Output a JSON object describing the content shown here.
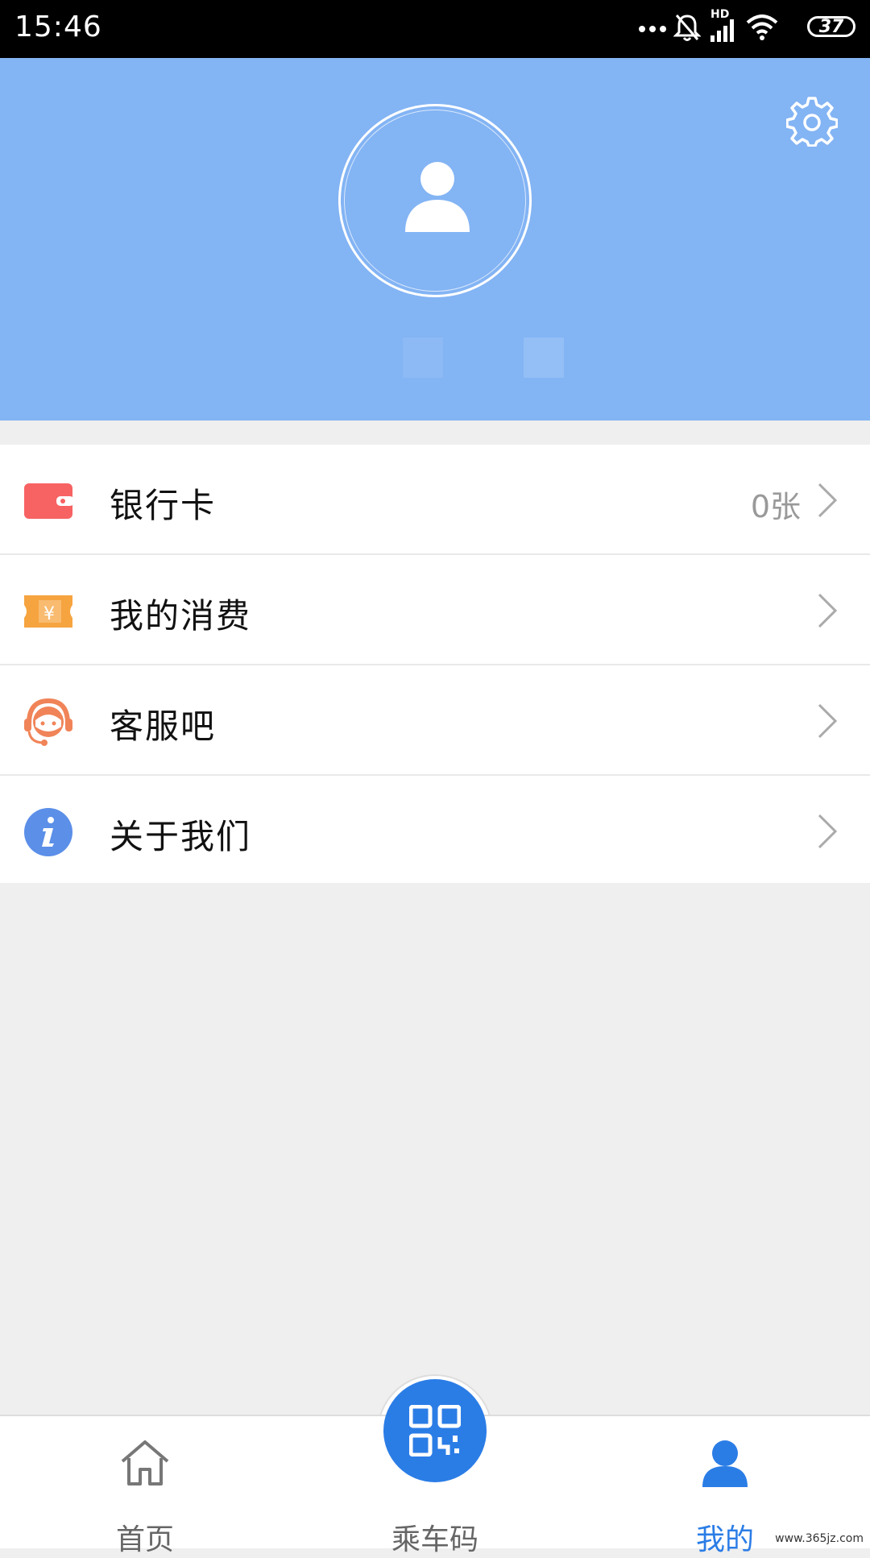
{
  "status_bar": {
    "time": "15:46",
    "battery": "37",
    "network": "HD"
  },
  "header": {
    "background_color": "#83b4f4",
    "settings_icon": "gear-icon",
    "avatar_icon": "user-icon"
  },
  "menu": {
    "items": [
      {
        "label": "银行卡",
        "value": "0张",
        "icon": "wallet-icon",
        "icon_color": "#f76263"
      },
      {
        "label": "我的消费",
        "value": "",
        "icon": "ticket-icon",
        "icon_color": "#f6a440"
      },
      {
        "label": "客服吧",
        "value": "",
        "icon": "headset-icon",
        "icon_color": "#f08458"
      },
      {
        "label": "关于我们",
        "value": "",
        "icon": "info-icon",
        "icon_color": "#5b8fe8"
      }
    ]
  },
  "tab_bar": {
    "tabs": [
      {
        "label": "首页",
        "icon": "home-icon",
        "active": false
      },
      {
        "label": "乘车码",
        "icon": "qr-code-icon",
        "active": false
      },
      {
        "label": "我的",
        "icon": "profile-icon",
        "active": true
      }
    ],
    "accent_color": "#2b7de6"
  },
  "watermark": "www.365jz.com"
}
